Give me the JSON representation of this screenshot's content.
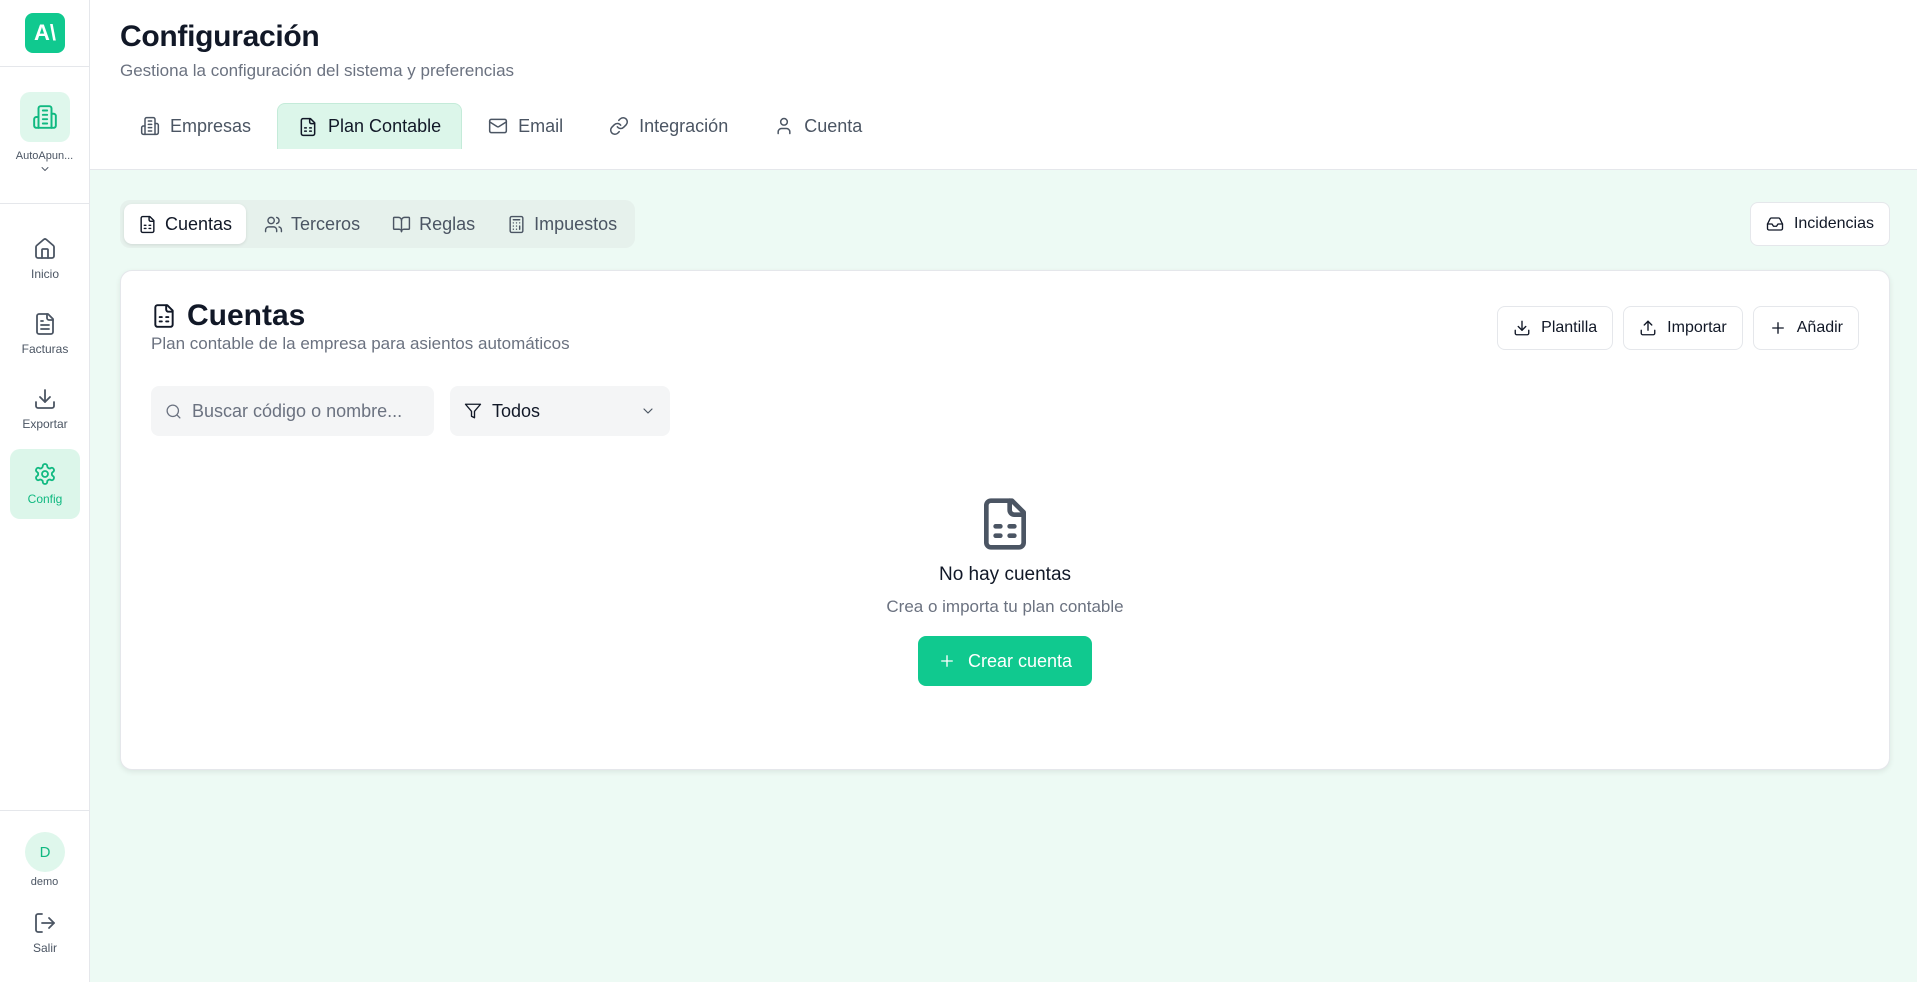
{
  "sidebar": {
    "logo_text": "A\\",
    "company_name": "AutoApun...",
    "items": [
      {
        "label": "Inicio",
        "icon": "home-icon"
      },
      {
        "label": "Facturas",
        "icon": "file-text-icon"
      },
      {
        "label": "Exportar",
        "icon": "download-icon"
      },
      {
        "label": "Config",
        "icon": "gear-icon",
        "active": true
      }
    ],
    "user_initial": "D",
    "user_name": "demo",
    "logout_label": "Salir"
  },
  "header": {
    "title": "Configuración",
    "subtitle": "Gestiona la configuración del sistema y preferencias",
    "tabs": [
      {
        "label": "Empresas",
        "icon": "building-icon"
      },
      {
        "label": "Plan Contable",
        "icon": "file-spreadsheet-icon",
        "active": true
      },
      {
        "label": "Email",
        "icon": "mail-icon"
      },
      {
        "label": "Integración",
        "icon": "link-icon"
      },
      {
        "label": "Cuenta",
        "icon": "user-icon"
      }
    ]
  },
  "subtabs": [
    {
      "label": "Cuentas",
      "icon": "file-spreadsheet-icon",
      "active": true
    },
    {
      "label": "Terceros",
      "icon": "users-icon"
    },
    {
      "label": "Reglas",
      "icon": "book-icon"
    },
    {
      "label": "Impuestos",
      "icon": "calculator-icon"
    }
  ],
  "incidencias_label": "Incidencias",
  "card": {
    "title": "Cuentas",
    "subtitle": "Plan contable de la empresa para asientos automáticos",
    "actions": {
      "template_label": "Plantilla",
      "import_label": "Importar",
      "add_label": "Añadir"
    },
    "search": {
      "placeholder": "Buscar código o nombre...",
      "value": ""
    },
    "filter": {
      "selected": "Todos"
    },
    "empty": {
      "title": "No hay cuentas",
      "subtitle": "Crea o importa tu plan contable",
      "button_label": "Crear cuenta"
    }
  },
  "colors": {
    "accent": "#10c98f",
    "accent_light": "#dcf6ea",
    "main_bg": "#edfaf4"
  }
}
